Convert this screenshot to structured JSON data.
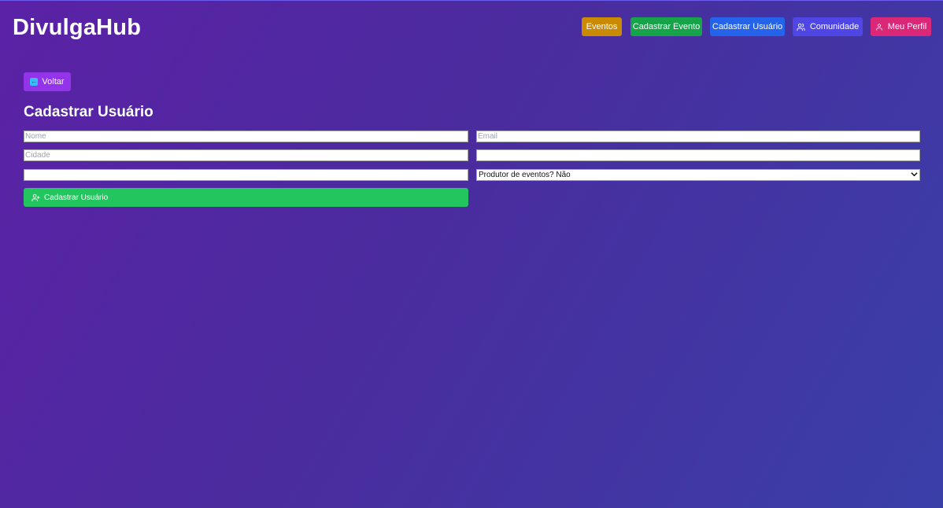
{
  "app": {
    "brand": "DivulgaHub"
  },
  "nav": {
    "eventos": "Eventos",
    "cadastrar_evento": "Cadastrar Evento",
    "cadastrar_usuario": "Cadastrar Usuário",
    "comunidade": "Comunidade",
    "meu_perfil": "Meu Perfil"
  },
  "page": {
    "back_label": "Voltar",
    "title": "Cadastrar Usuário"
  },
  "form": {
    "nome_placeholder": "Nome",
    "email_placeholder": "Email",
    "cidade_placeholder": "Cidade",
    "field4_value": "",
    "field5_value": "",
    "produtor_select_value": "Produtor de eventos? Não",
    "submit_label": "Cadastrar Usuário"
  },
  "colors": {
    "eventos": "#ca8a04",
    "cadastrar_evento": "#16a34a",
    "cadastrar_usuario": "#2563eb",
    "comunidade": "#4f46e5",
    "meu_perfil": "#db2777",
    "voltar": "#9333ea",
    "submit": "#22c55e"
  },
  "icons": {
    "comunidade": "users-icon",
    "meu_perfil": "user-icon",
    "voltar": "arrow-left-icon",
    "submit": "user-plus-icon",
    "select": "chevron-down-icon"
  }
}
